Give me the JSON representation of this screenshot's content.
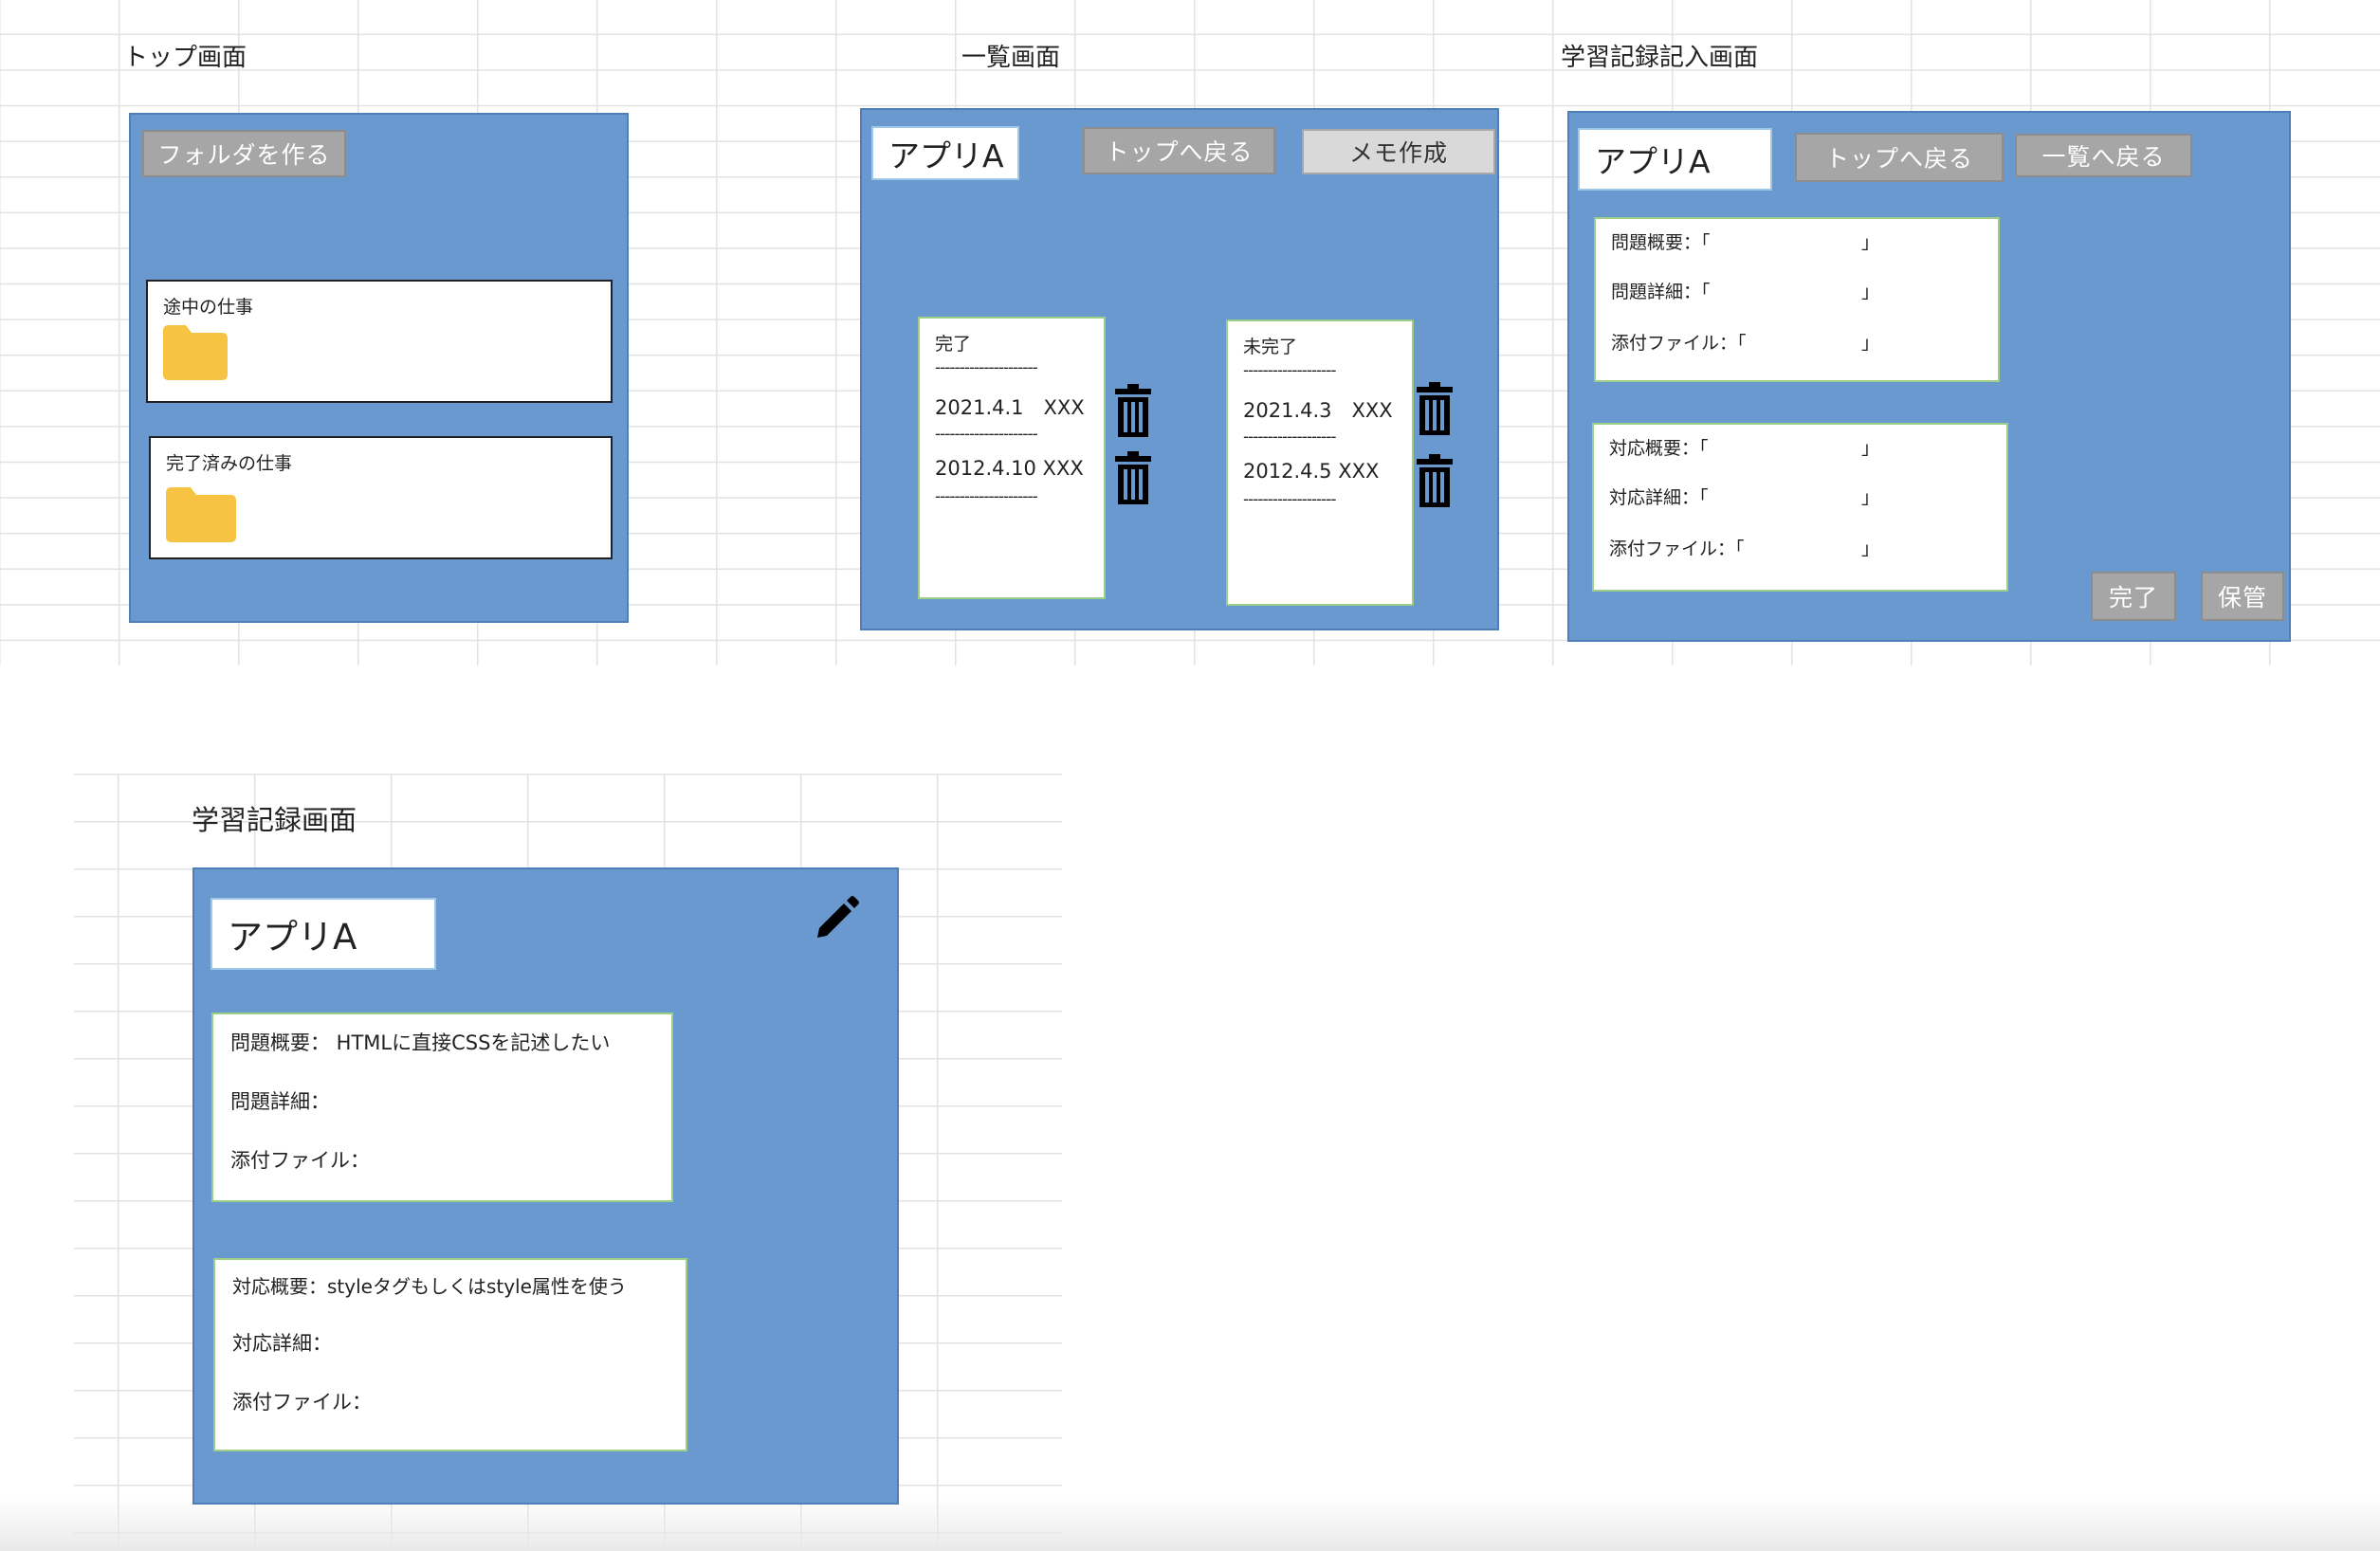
{
  "top_screen": {
    "label": "トップ画面",
    "make_folder_button": "フォルダを作る",
    "folders": [
      {
        "label": "途中の仕事"
      },
      {
        "label": "完了済みの仕事"
      }
    ]
  },
  "list_screen": {
    "label": "一覧画面",
    "app_title": "アプリA",
    "back_to_top_button": "トップへ戻る",
    "create_memo_button": "メモ作成",
    "done_column": {
      "header": "完了",
      "separator": "---------------------",
      "items": [
        "2021.4.1　XXX",
        "2012.4.10 XXX"
      ]
    },
    "undone_column": {
      "header": "未完了",
      "separator": "-------------------",
      "items": [
        "2021.4.3　XXX",
        "2012.4.5 XXX"
      ]
    }
  },
  "entry_screen": {
    "label": "学習記録記入画面",
    "app_title": "アプリA",
    "back_to_top_button": "トップへ戻る",
    "back_to_list_button": "一覧へ戻る",
    "problem_fields": [
      {
        "label": "問題概要：「",
        "close": "」"
      },
      {
        "label": "問題詳細：「",
        "close": "」"
      },
      {
        "label": "添付ファイル：「",
        "close": "」"
      }
    ],
    "response_fields": [
      {
        "label": "対応概要：「",
        "close": "」"
      },
      {
        "label": "対応詳細：「",
        "close": "」"
      },
      {
        "label": "添付ファイル：「",
        "close": "」"
      }
    ],
    "complete_button": "完了",
    "save_button": "保管"
  },
  "record_screen": {
    "label": "学習記録画面",
    "app_title": "アプリA",
    "problem_summary": "問題概要： HTMLに直接CSSを記述したい",
    "problem_detail": "問題詳細：",
    "problem_attachment": "添付ファイル：",
    "response_summary": "対応概要：styleタグもしくはstyle属性を使う",
    "response_detail": "対応詳細：",
    "response_attachment": "添付ファイル："
  },
  "colors": {
    "panel": "#6a99cf",
    "folder": "#f6c343",
    "button_gray": "#a6a6a6"
  }
}
